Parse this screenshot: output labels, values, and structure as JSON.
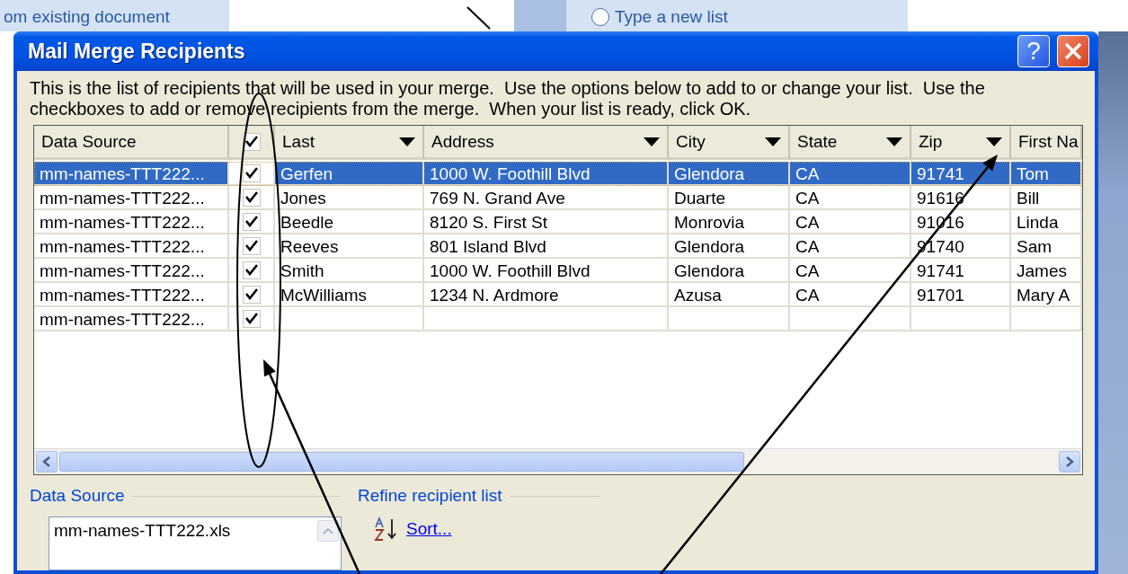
{
  "background": {
    "caption": "om existing document",
    "radio": {
      "label": "Type a new list",
      "selected": false
    }
  },
  "dialog": {
    "title": "Mail Merge Recipients",
    "help_button": "?",
    "intro": "This is the list of recipients that will be used in your merge.  Use the options below to add to or change your list.  Use the checkboxes to add or remove recipients from the merge.  When your list is ready, click OK.",
    "select_all": {
      "checked": true
    },
    "columns": [
      {
        "kind": "text",
        "label": "Data Source",
        "dropdown": false
      },
      {
        "kind": "text",
        "label": "Last",
        "dropdown": true
      },
      {
        "kind": "text",
        "label": "Address",
        "dropdown": true
      },
      {
        "kind": "text",
        "label": "City",
        "dropdown": true
      },
      {
        "kind": "text",
        "label": "State",
        "dropdown": true
      },
      {
        "kind": "text",
        "label": "Zip",
        "dropdown": true
      },
      {
        "kind": "text",
        "label": "First Na"
      }
    ],
    "rows": [
      {
        "checked": true,
        "selected": true,
        "cells": [
          "mm-names-TTT222...",
          "Gerfen",
          "1000 W. Foothill Blvd",
          "Glendora",
          "CA",
          "91741",
          "Tom"
        ]
      },
      {
        "checked": true,
        "selected": false,
        "cells": [
          "mm-names-TTT222...",
          "Jones",
          "769 N. Grand Ave",
          "Duarte",
          "CA",
          "91616",
          "Bill"
        ]
      },
      {
        "checked": true,
        "selected": false,
        "cells": [
          "mm-names-TTT222...",
          "Beedle",
          "8120 S. First St",
          "Monrovia",
          "CA",
          "91016",
          "Linda"
        ]
      },
      {
        "checked": true,
        "selected": false,
        "cells": [
          "mm-names-TTT222...",
          "Reeves",
          "801 Island Blvd",
          "Glendora",
          "CA",
          "91740",
          "Sam"
        ]
      },
      {
        "checked": true,
        "selected": false,
        "cells": [
          "mm-names-TTT222...",
          "Smith",
          "1000 W. Foothill Blvd",
          "Glendora",
          "CA",
          "91741",
          "James"
        ]
      },
      {
        "checked": true,
        "selected": false,
        "cells": [
          "mm-names-TTT222...",
          "McWilliams",
          "1234 N. Ardmore",
          "Azusa",
          "CA",
          "91701",
          "Mary A"
        ]
      },
      {
        "checked": true,
        "selected": false,
        "cells": [
          "mm-names-TTT222...",
          "",
          "",
          "",
          "",
          "",
          ""
        ]
      }
    ],
    "data_source": {
      "label": "Data Source",
      "items": [
        "mm-names-TTT222.xls"
      ]
    },
    "refine": {
      "label": "Refine recipient list",
      "links": [
        "Sort..."
      ]
    }
  }
}
